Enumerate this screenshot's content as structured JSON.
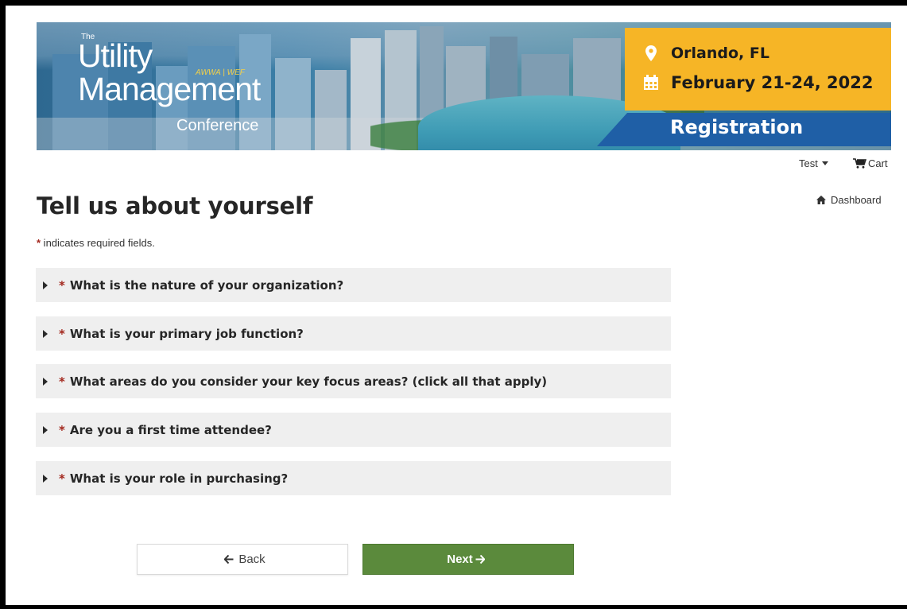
{
  "banner": {
    "logo_the": "The",
    "logo_utility": "Utility",
    "logo_management": "Management",
    "logo_awwa": "AWWA | WEF",
    "logo_conference": "Conference",
    "location": "Orlando, FL",
    "dates": "February 21-24, 2022",
    "registration": "Registration"
  },
  "nav": {
    "user": "Test",
    "cart": "Cart",
    "dashboard": "Dashboard"
  },
  "page": {
    "title": "Tell us about yourself",
    "required_star": "*",
    "required_note": " indicates required fields."
  },
  "questions": [
    {
      "label": "What is the nature of your organization?"
    },
    {
      "label": "What is your primary job function?"
    },
    {
      "label": "What areas do you consider your key focus areas? (click all that apply)"
    },
    {
      "label": "Are you a first time attendee?"
    },
    {
      "label": "What is your role in purchasing?"
    }
  ],
  "buttons": {
    "back": "Back",
    "next": "Next"
  },
  "colors": {
    "banner_yellow": "#f6b526",
    "banner_blue": "#1f5fa6",
    "required_star": "#a3281e",
    "next_button": "#5b8a3c",
    "question_bg": "#efefef"
  },
  "icons": {
    "location": "map-pin-icon",
    "date": "calendar-icon",
    "user_menu": "caret-down-icon",
    "cart": "cart-icon",
    "dashboard": "home-icon",
    "back": "arrow-left-icon",
    "next": "arrow-right-icon",
    "question_toggle": "caret-right-icon"
  }
}
